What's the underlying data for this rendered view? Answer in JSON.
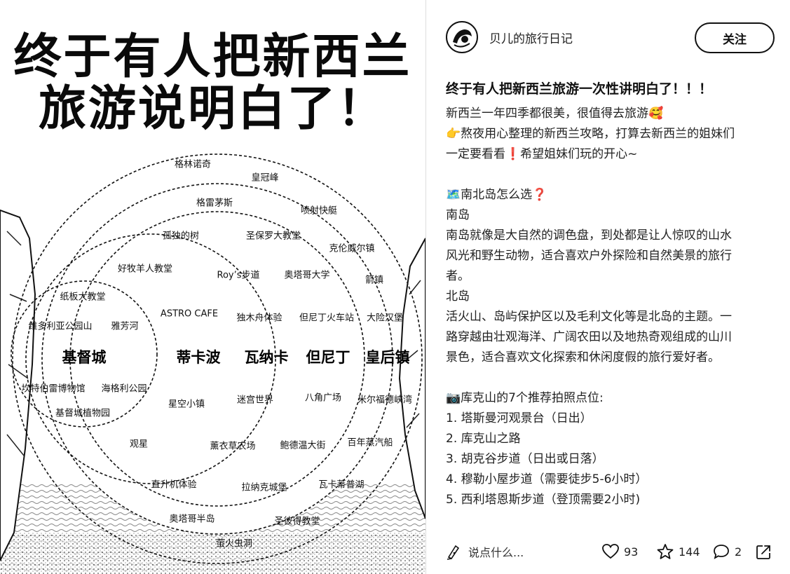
{
  "poster": {
    "title_line1": "终于有人把新西兰",
    "title_line2": "旅游说明白了！",
    "cities": [
      {
        "key": "c1",
        "name": "基督城"
      },
      {
        "key": "c2",
        "name": "蒂卡波"
      },
      {
        "key": "c3",
        "name": "瓦纳卡"
      },
      {
        "key": "c4",
        "name": "但尼丁"
      },
      {
        "key": "c5",
        "name": "皇后镇"
      }
    ],
    "spots": {
      "s1": "格林诺奇",
      "s2": "皇冠峰",
      "s3": "格雷茅斯",
      "s4": "喷射快艇",
      "s5": "孤独的树",
      "s6": "圣保罗大教堂",
      "s7": "克伦威尔镇",
      "s8": "好牧羊人教堂",
      "s9": "Roy’s步道",
      "s10": "奥塔哥大学",
      "s11": "箭镇",
      "s12": "纸板大教堂",
      "s13": "ASTRO CAFE",
      "s14": "独木舟体验",
      "s15": "但尼丁火车站",
      "s16": "大险汉堡",
      "s17": "维多利亚公园山",
      "s18": "雅芳河",
      "s19": "坎特伯雷博物馆",
      "s20": "海格利公园",
      "s21": "星空小镇",
      "s22": "迷宫世界",
      "s23": "八角广场",
      "s24": "米尔福德峡湾",
      "s25": "基督城植物园",
      "s26": "观星",
      "s27": "薰衣草农场",
      "s28": "鲍德温大街",
      "s29": "百年蒸汽船",
      "s30": "直升机体验",
      "s31": "拉纳克城堡",
      "s32": "瓦卡蒂普湖",
      "s33": "奥塔哥半岛",
      "s34": "圣彼得教堂",
      "s35": "萤火虫洞"
    }
  },
  "note": {
    "author": "贝儿的旅行日记",
    "follow_label": "关注",
    "title": "终于有人把新西兰旅游一次性讲明白了！！！",
    "lines": [
      "新西兰一年四季都很美，很值得去旅游🥰",
      "👉熬夜用心整理的新西兰攻略，打算去新西兰的姐妹们",
      "一定要看看❗希望姐妹们玩的开心~",
      "",
      "🗺️南北岛怎么选❓",
      "南岛",
      "南岛就像是大自然的调色盘，到处都是让人惊叹的山水",
      "风光和野生动物，适合喜欢户外探险和自然美景的旅行",
      "者。",
      "北岛",
      "活火山、岛屿保护区以及毛利文化等是北岛的主题。一",
      "路穿越由壮观海洋、广阔农田以及地热奇观组成的山川",
      "景色，适合喜欢文化探索和休闲度假的旅行爱好者。",
      "",
      "📷库克山的7个推荐拍照点位:",
      "1. 塔斯曼河观景台（日出）",
      "2. 库克山之路",
      "3. 胡克谷步道（日出或日落）",
      "4. 穆勒小屋步道（需要徒步5-6小时）",
      "5. 西利塔恩斯步道（登顶需要2小时)"
    ]
  },
  "bottom": {
    "comment_placeholder": "说点什么...",
    "likes": "93",
    "collects": "144",
    "comments": "2"
  },
  "icons": {
    "avatar": "avatar-icon",
    "comment_trigger": "pen-icon",
    "likes": "heart-icon",
    "collects": "star-icon",
    "comments": "comment-bubble-icon",
    "share": "share-icon"
  }
}
